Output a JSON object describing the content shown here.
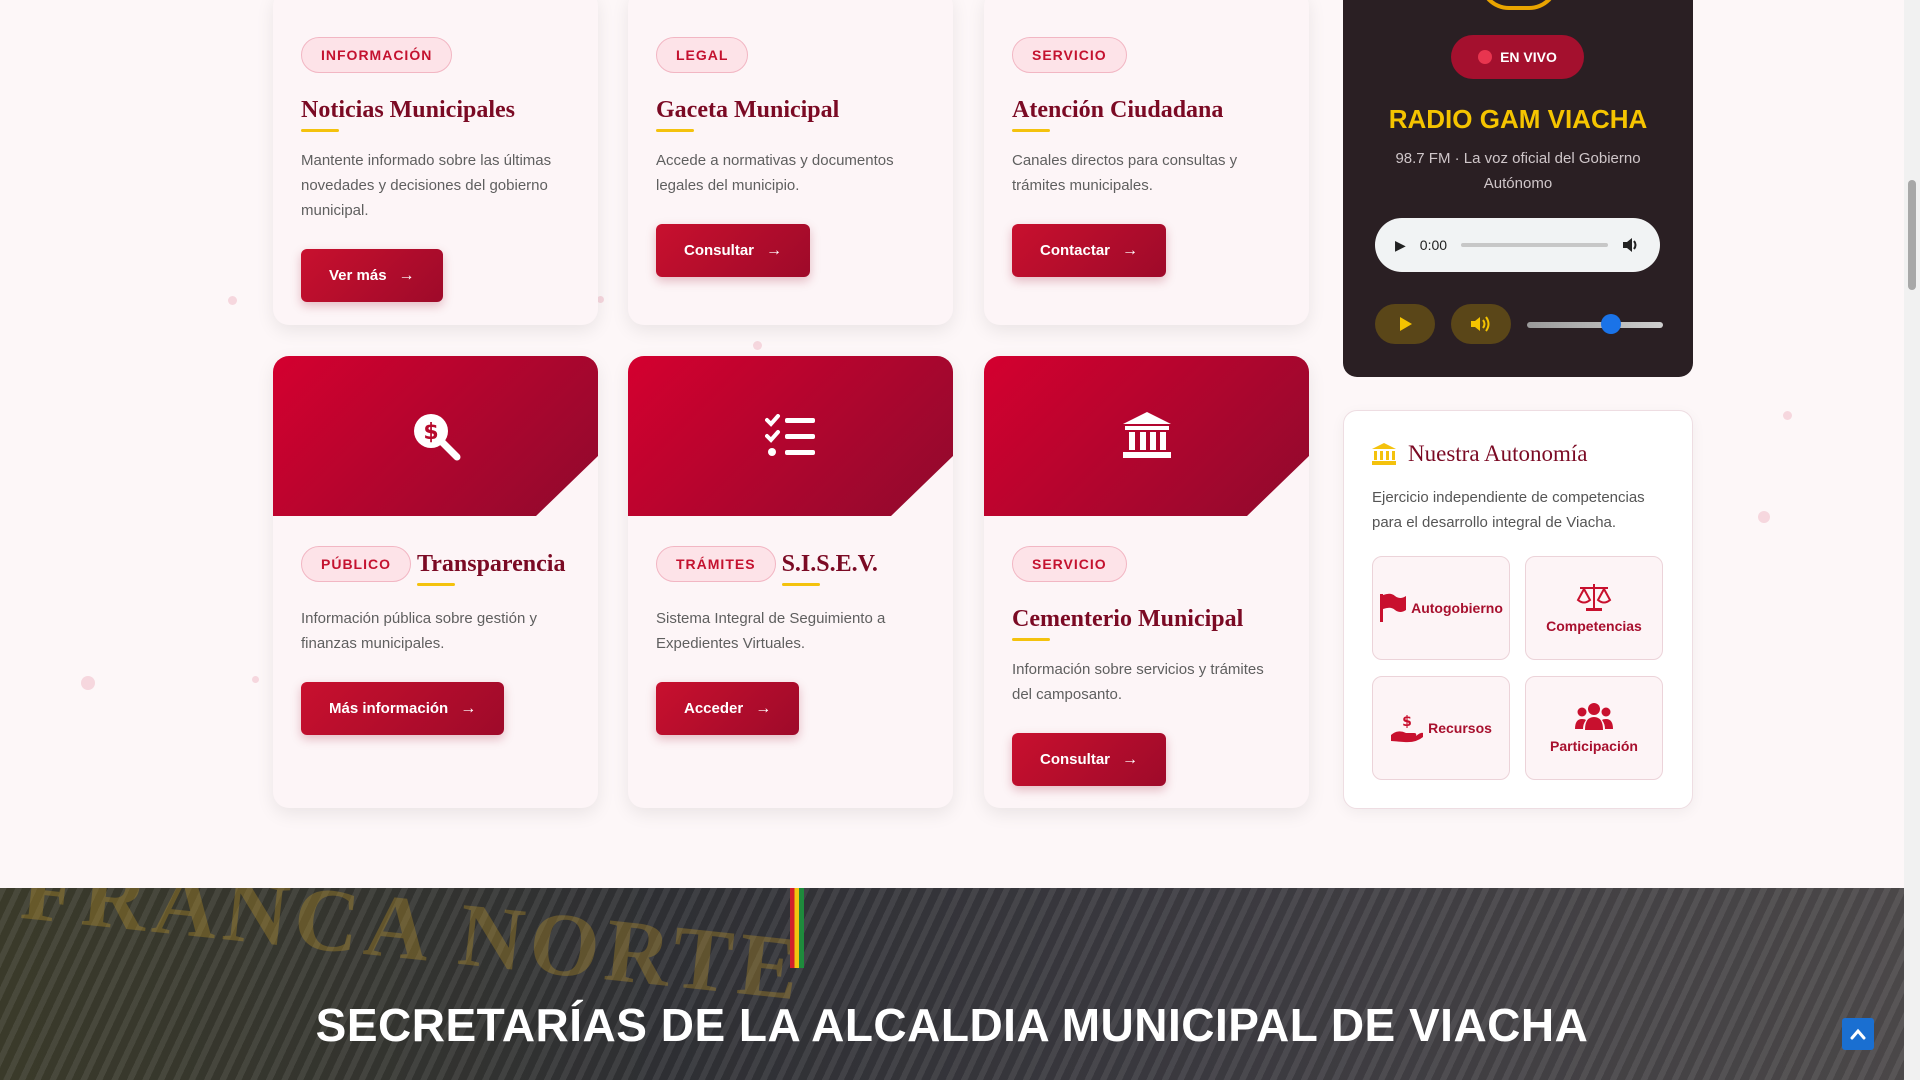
{
  "cards_top": [
    {
      "badge": "INFORMACIÓN",
      "title": "Noticias Municipales",
      "desc": "Mantente informado sobre las últimas novedades y decisiones del gobierno municipal.",
      "button": "Ver más"
    },
    {
      "badge": "LEGAL",
      "title": "Gaceta Municipal",
      "desc": "Accede a normativas y documentos legales del municipio.",
      "button": "Consultar"
    },
    {
      "badge": "SERVICIO",
      "title": "Atención Ciudadana",
      "desc": "Canales directos para consultas y trámites municipales.",
      "button": "Contactar"
    }
  ],
  "cards_bottom": [
    {
      "icon": "search-dollar-icon",
      "badge": "PÚBLICO",
      "title": "Transparencia",
      "desc": "Información pública sobre gestión y finanzas municipales.",
      "button": "Más información"
    },
    {
      "icon": "tasks-list-icon",
      "badge": "TRÁMITES",
      "title": "S.I.S.E.V.",
      "desc": "Sistema Integral de Seguimiento a Expedientes Virtuales.",
      "button": "Acceder"
    },
    {
      "icon": "landmark-icon",
      "badge": "SERVICIO",
      "title": "Cementerio Municipal",
      "desc": "Información sobre servicios y trámites del camposanto.",
      "button": "Consultar"
    }
  ],
  "radio": {
    "live_label": "EN VIVO",
    "title": "RADIO GAM VIACHA",
    "subtitle": "98.7 FM · La voz oficial del Gobierno Autónomo",
    "audio_time": "0:00",
    "volume_level": 0.62,
    "accent_color": "#f5c400"
  },
  "autonomy": {
    "title": "Nuestra Autonomía",
    "desc": "Ejercicio independiente de competencias para el desarrollo integral de Viacha.",
    "tiles": [
      {
        "label": "Autogobierno",
        "icon": "flag-icon"
      },
      {
        "label": "Competencias",
        "icon": "balance-scale-icon"
      },
      {
        "label": "Recursos",
        "icon": "hand-dollar-icon"
      },
      {
        "label": "Participación",
        "icon": "users-icon"
      }
    ]
  },
  "banner": {
    "title": "SECRETARÍAS DE LA ALCALDIA MUNICIPAL DE VIACHA"
  },
  "colors": {
    "brand": "#c8102e",
    "dark_red": "#7b0a24",
    "gold": "#f4c20d"
  }
}
